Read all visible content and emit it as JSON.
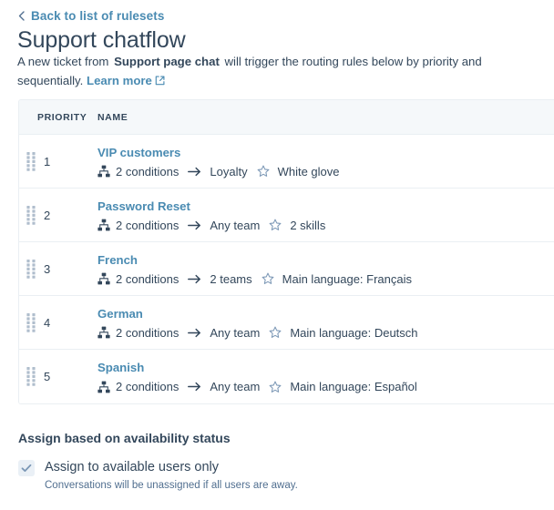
{
  "back_link": {
    "label": "Back to list of rulesets",
    "icon": "chevron-left-icon"
  },
  "page_title": "Support chatflow",
  "description": {
    "prefix": "A new ticket from",
    "chat_name": "Support page chat",
    "middle": "will trigger the routing rules below by priority and sequentially.",
    "learn_more": "Learn more",
    "learn_more_icon": "external-link-icon"
  },
  "table": {
    "columns": {
      "priority": "PRIORITY",
      "name": "NAME"
    },
    "rows": [
      {
        "priority": "1",
        "name": "VIP customers",
        "conditions": "2 conditions",
        "target": "Loyalty",
        "skill": "White glove"
      },
      {
        "priority": "2",
        "name": "Password Reset",
        "conditions": "2 conditions",
        "target": "Any team",
        "skill": "2 skills"
      },
      {
        "priority": "3",
        "name": "French",
        "conditions": "2 conditions",
        "target": "2 teams",
        "skill": "Main language: Français"
      },
      {
        "priority": "4",
        "name": "German",
        "conditions": "2 conditions",
        "target": "Any team",
        "skill": "Main language: Deutsch"
      },
      {
        "priority": "5",
        "name": "Spanish",
        "conditions": "2 conditions",
        "target": "Any team",
        "skill": "Main language: Español"
      }
    ],
    "icons": {
      "drag": "drag-handle-icon",
      "conditions": "sitemap-icon",
      "target": "arrow-right-icon",
      "skill": "star-outline-icon"
    }
  },
  "availability": {
    "title": "Assign based on availability status",
    "checkbox_label": "Assign to available users only",
    "checkbox_help": "Conversations will be unassigned if all users are away.",
    "checked": true
  },
  "colors": {
    "link": "#4a8bb2",
    "text": "#33475b",
    "muted": "#516f90",
    "border": "#eaeff3",
    "header_bg": "#f5f8fa",
    "checkbox_bg": "#eaf0f6"
  }
}
